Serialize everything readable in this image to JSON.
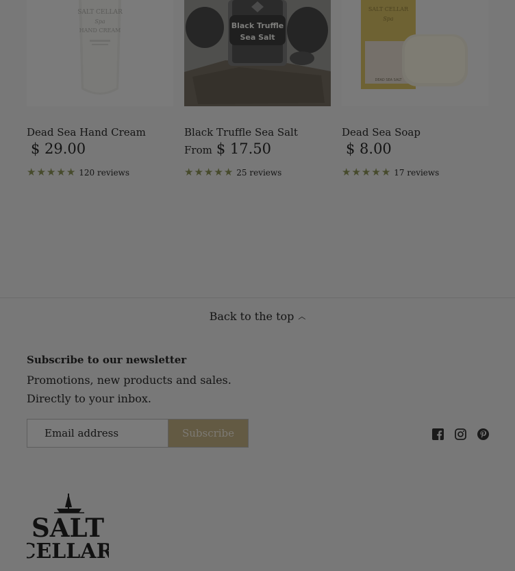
{
  "products": [
    {
      "name": "Dead Sea Hand Cream",
      "price_prefix": "",
      "price": "$ 29.00",
      "rating": 4.9,
      "reviews": "120 reviews",
      "image_label_top": "SALT CELLAR",
      "image_label_mid": "Spa",
      "image_label_bottom": "HAND CREAM"
    },
    {
      "name": "Black Truffle Sea Salt",
      "price_prefix": "From",
      "price": "$ 17.50",
      "rating": 4.9,
      "reviews": "25 reviews",
      "image_label_top": "Black Truffle",
      "image_label_bottom": "Sea Salt"
    },
    {
      "name": "Dead Sea Soap",
      "price_prefix": "",
      "price": "$ 8.00",
      "rating": 4.9,
      "reviews": "17 reviews",
      "image_label_top": "SALT CELLAR",
      "image_label_mid": "Spa",
      "image_label_bottom": "DEAD SEA SALT"
    }
  ],
  "footer": {
    "back_to_top": "Back to the top",
    "newsletter_title": "Subscribe to our newsletter",
    "newsletter_desc": "Promotions, new products and sales. Directly to your inbox.",
    "email_placeholder": "Email address",
    "subscribe_label": "Subscribe",
    "social": [
      "facebook-icon",
      "instagram-icon",
      "pinterest-icon"
    ],
    "logo_line1": "SALT",
    "logo_line2": "CELLAR"
  },
  "colors": {
    "overlay_bg": "#787878",
    "star": "#474b2c",
    "subscribe_bg": "#635a43"
  }
}
